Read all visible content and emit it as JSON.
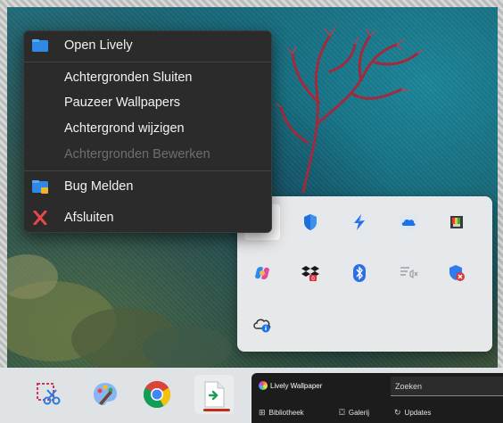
{
  "context_menu": {
    "items": [
      {
        "label": "Open Lively",
        "icon": "lively-folder-icon",
        "enabled": true
      },
      {
        "label": "Achtergronden Sluiten",
        "enabled": true
      },
      {
        "label": "Pauzeer Wallpapers",
        "enabled": true
      },
      {
        "label": "Achtergrond wijzigen",
        "enabled": true
      },
      {
        "label": "Achtergronden Bewerken",
        "enabled": false
      },
      {
        "label": "Bug Melden",
        "icon": "bug-report-icon",
        "enabled": true
      },
      {
        "label": "Afsluiten",
        "icon": "close-x-icon",
        "enabled": true
      }
    ]
  },
  "tray_flyout": {
    "icons": [
      "lively-tray-icon",
      "defender-shield-icon",
      "power-automate-icon",
      "onedrive-cloud-icon",
      "color-picker-icon",
      "copilot-icon",
      "dropbox-icon",
      "bluetooth-icon",
      "presentation-mute-icon",
      "security-warning-icon",
      "cloud-info-icon"
    ]
  },
  "taskbar": {
    "apps": [
      "snipping-tool-icon",
      "paint-icon",
      "chrome-icon",
      "green-arrow-app-icon"
    ]
  },
  "lively_preview": {
    "title": "Lively Wallpaper",
    "search_value": "Zoeken",
    "nav": [
      {
        "label": "Bibliotheek",
        "icon": "grid-icon"
      },
      {
        "label": "Galerij",
        "icon": "bag-icon"
      },
      {
        "label": "Updates",
        "icon": "refresh-icon"
      }
    ]
  },
  "colors": {
    "menu_bg": "#2b2b2b",
    "accent_red": "#c42b1c",
    "tray_bg": "#eeeef0"
  }
}
